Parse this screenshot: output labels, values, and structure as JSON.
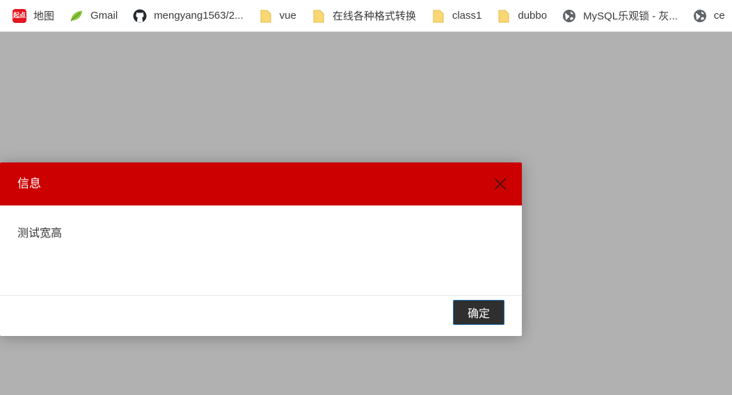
{
  "bookmarks": [
    {
      "label": "地图",
      "icon": "qidian-icon",
      "badge": "起点"
    },
    {
      "label": "Gmail",
      "icon": "leaf-icon"
    },
    {
      "label": "mengyang1563/2...",
      "icon": "github-icon"
    },
    {
      "label": "vue",
      "icon": "folder-icon"
    },
    {
      "label": "在线各种格式转换",
      "icon": "folder-icon"
    },
    {
      "label": "class1",
      "icon": "folder-icon"
    },
    {
      "label": "dubbo",
      "icon": "folder-icon"
    },
    {
      "label": "MySQL乐观锁 - 灰...",
      "icon": "globe-icon"
    },
    {
      "label": "ce",
      "icon": "globe-icon"
    }
  ],
  "dialog": {
    "title": "信息",
    "message": "测试宽高",
    "ok_label": "确定",
    "header_color": "#cc0000",
    "close_icon": "close-icon"
  },
  "colors": {
    "overlay": "#b1b1b1",
    "header": "#cc0000",
    "button_bg": "#2f2f2f",
    "button_border": "#1e6fb8"
  }
}
